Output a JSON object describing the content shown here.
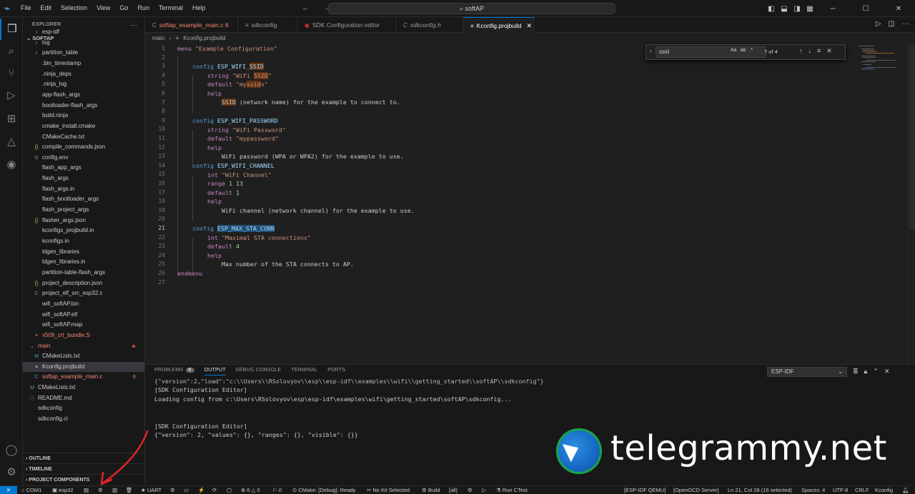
{
  "titlebar": {
    "menus": [
      "File",
      "Edit",
      "Selection",
      "View",
      "Go",
      "Run",
      "Terminal",
      "Help"
    ],
    "search": "softAP"
  },
  "explorer": {
    "header": "EXPLORER",
    "root": "SOFTAP",
    "items": [
      {
        "label": "esp-idf",
        "type": "folder"
      },
      {
        "label": "log",
        "type": "folder"
      },
      {
        "label": "partition_table",
        "type": "folder"
      },
      {
        "label": ".bin_timestamp",
        "type": "file"
      },
      {
        "label": ".ninja_deps",
        "type": "file"
      },
      {
        "label": ".ninja_log",
        "type": "file"
      },
      {
        "label": "app-flash_args",
        "type": "file"
      },
      {
        "label": "bootloader-flash_args",
        "type": "file"
      },
      {
        "label": "build.ninja",
        "type": "file"
      },
      {
        "label": "cmake_install.cmake",
        "type": "file"
      },
      {
        "label": "CMakeCache.txt",
        "type": "file"
      },
      {
        "label": "compile_commands.json",
        "type": "json"
      },
      {
        "label": "config.env",
        "type": "gear"
      },
      {
        "label": "flash_app_args",
        "type": "file"
      },
      {
        "label": "flash_args",
        "type": "file"
      },
      {
        "label": "flash_args.in",
        "type": "file"
      },
      {
        "label": "flash_bootloader_args",
        "type": "file"
      },
      {
        "label": "flash_project_args",
        "type": "file"
      },
      {
        "label": "flasher_args.json",
        "type": "json"
      },
      {
        "label": "kconfigs_projbuild.in",
        "type": "file"
      },
      {
        "label": "kconfigs.in",
        "type": "file"
      },
      {
        "label": "ldgen_libraries",
        "type": "file"
      },
      {
        "label": "ldgen_libraries.in",
        "type": "file"
      },
      {
        "label": "partition-table-flash_args",
        "type": "file"
      },
      {
        "label": "project_description.json",
        "type": "json"
      },
      {
        "label": "project_elf_src_esp32.c",
        "type": "c"
      },
      {
        "label": "wifi_softAP.bin",
        "type": "file"
      },
      {
        "label": "wifi_softAP.elf",
        "type": "file"
      },
      {
        "label": "wifi_softAP.map",
        "type": "file"
      },
      {
        "label": "x509_crt_bundle.S",
        "type": "asm"
      }
    ],
    "main_folder": "main",
    "main_items": [
      {
        "label": "CMakeLists.txt",
        "type": "cmake"
      },
      {
        "label": "Kconfig.projbuild",
        "type": "kconfig"
      },
      {
        "label": "softap_example_main.c",
        "type": "c",
        "count": "6"
      }
    ],
    "root_items": [
      {
        "label": "CMakeLists.txt",
        "type": "cmake"
      },
      {
        "label": "README.md",
        "type": "md"
      },
      {
        "label": "sdkconfig",
        "type": "file"
      },
      {
        "label": "sdkconfig.ci",
        "type": "file"
      }
    ],
    "sections": [
      "OUTLINE",
      "TIMELINE",
      "PROJECT COMPONENTS"
    ]
  },
  "tabs": [
    {
      "label": "softap_example_main.c",
      "count": "6"
    },
    {
      "label": "sdkconfig"
    },
    {
      "label": "SDK Configuration editor"
    },
    {
      "label": "sdkconfig.h"
    },
    {
      "label": "Kconfig.projbuild"
    }
  ],
  "breadcrumb": {
    "folder": "main",
    "file": "Kconfig.projbuild"
  },
  "find": {
    "query": "ssid",
    "opts": "Aa",
    "count": "? of 4"
  },
  "code": {
    "l1": [
      "menu",
      " ",
      "\"Example Configuration\""
    ],
    "l3": [
      "config",
      " ESP_WIFI_",
      "SSID"
    ],
    "l4a": "string",
    "l4b": " \"WiFi ",
    "l4c": "SSID",
    "l4d": "\"",
    "l5a": "default",
    "l5b": " \"my",
    "l5c": "ssid",
    "l5d": "s\"",
    "l6": "help",
    "l7a": "SSID",
    "l7b": " (network name) for the example to connect to.",
    "l9a": "config",
    "l9b": " ESP_WIFI_PASSWORD",
    "l10a": "string",
    "l10b": " \"WiFi Password\"",
    "l11a": "default",
    "l11b": " \"mypassword\"",
    "l12": "help",
    "l13": "WiFi password (WPA or WPA2) for the example to use.",
    "l14a": "config",
    "l14b": " ESP_WIFI_CHANNEL",
    "l15a": "int",
    "l15b": " \"WiFi Channel\"",
    "l16a": "range",
    "l16b": " 1 13",
    "l17a": "default",
    "l17b": " 1",
    "l18": "help",
    "l19": "WiFi channel (network channel) for the example to use.",
    "l21a": "config",
    "l21b": "ESP_MAX_STA_CONN",
    "l22a": "int",
    "l22b": " \"Maximal STA connections\"",
    "l23a": "default",
    "l23b": " 4",
    "l24": "help",
    "l25": "Max number of the STA connects to AP.",
    "l26": "endmenu"
  },
  "panel": {
    "tabs": [
      "PROBLEMS",
      "OUTPUT",
      "DEBUG CONSOLE",
      "TERMINAL",
      "PORTS"
    ],
    "problems_count": "6",
    "channel": "ESP-IDF",
    "lines": [
      "{\"version\":2,\"load\":\"c:\\\\Users\\\\RSolovyov\\\\esp\\\\esp-idf\\\\examples\\\\wifi\\\\getting_started\\\\softAP\\\\sdkconfig\"}",
      "[SDK Configuration Editor]",
      "Loading config from c:\\Users\\RSolovyov\\esp\\esp-idf\\examples\\wifi\\getting_started\\softAP\\sdkconfig...",
      "",
      "[SDK Configuration Editor]",
      "{\"version\": 2, \"values\": {}, \"ranges\": {}, \"visible\": {}}"
    ]
  },
  "watermark": "telegrammy.net",
  "statusbar": {
    "com": "COM1",
    "target": "esp32",
    "uart": "UART",
    "problems": "6",
    "warnings": "0",
    "info": "0",
    "cmake": "CMake: [Debug]: Ready",
    "kit": "No Kit Selected",
    "build": "Build",
    "all": "[all]",
    "ctest": "Run CTest",
    "qemu": "[ESP-IDF QEMU]",
    "openocd": "[OpenOCD Server]",
    "position": "Ln 21, Col 28 (16 selected)",
    "spaces": "Spaces: 4",
    "encoding": "UTF-8",
    "eol": "CRLF",
    "lang": "Kconfig"
  }
}
